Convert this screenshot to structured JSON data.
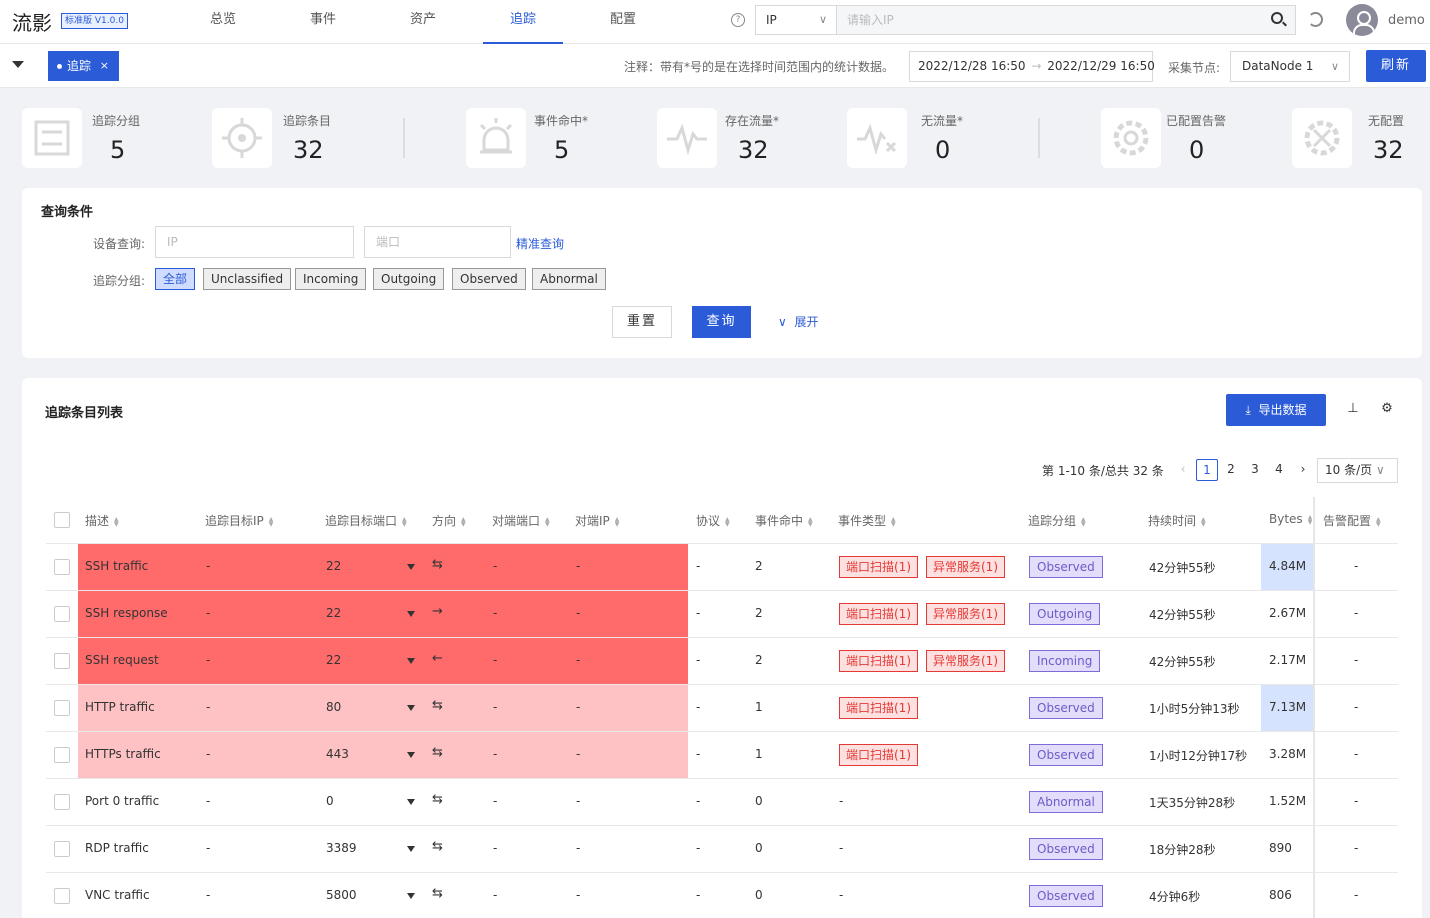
{
  "app": {
    "logo": "流影",
    "version": "标准版 V1.0.0"
  },
  "nav": [
    {
      "label": "总览"
    },
    {
      "label": "事件"
    },
    {
      "label": "资产"
    },
    {
      "label": "追踪"
    },
    {
      "label": "配置"
    }
  ],
  "search": {
    "type": "IP",
    "placeholder": "请输入IP"
  },
  "user": {
    "name": "demo"
  },
  "subbar": {
    "tab": "追踪",
    "tab_close": "×",
    "note": "注释：带有*号的是在选择时间范围内的统计数据。",
    "date_start": "2022/12/28 16:50",
    "date_arrow": "→",
    "date_end": "2022/12/29 16:50",
    "node_label": "采集节点:",
    "node_value": "DataNode 1",
    "refresh": "刷新"
  },
  "stats": [
    {
      "label": "追踪分组",
      "value": "5"
    },
    {
      "label": "追踪条目",
      "value": "32"
    },
    {
      "label": "事件命中*",
      "value": "5"
    },
    {
      "label": "存在流量*",
      "value": "32"
    },
    {
      "label": "无流量*",
      "value": "0"
    },
    {
      "label": "已配置告警",
      "value": "0"
    },
    {
      "label": "无配置",
      "value": "32"
    }
  ],
  "query": {
    "title": "查询条件",
    "device_label": "设备查询:",
    "ip_placeholder": "IP",
    "port_placeholder": "端口",
    "exact_link": "精准查询",
    "group_label": "追踪分组:",
    "groups": [
      "全部",
      "Unclassified",
      "Incoming",
      "Outgoing",
      "Observed",
      "Abnormal"
    ],
    "reset": "重置",
    "submit": "查询",
    "expand": "展开"
  },
  "list": {
    "title": "追踪条目列表",
    "export": "导出数据",
    "pager_info": "第 1-10 条/总共 32 条",
    "pages": [
      "1",
      "2",
      "3",
      "4"
    ],
    "prev": "‹",
    "next": "›",
    "page_size": "10 条/页",
    "columns": [
      "描述",
      "追踪目标IP",
      "追踪目标端口",
      "方向",
      "对端端口",
      "对端IP",
      "协议",
      "事件命中",
      "事件类型",
      "追踪分组",
      "持续时间",
      "Bytes",
      "告警配置"
    ],
    "rows": [
      {
        "desc": "SSH traffic",
        "ip": "-",
        "port": "22",
        "dir": "⇆",
        "peer_port": "-",
        "peer_ip": "-",
        "proto": "-",
        "hits": "2",
        "tags": [
          "端口扫描(1)",
          "异常服务(1)"
        ],
        "none": "",
        "group": "Observed",
        "duration": "42分钟55秒",
        "bytes": "4.84M",
        "alarm": "-"
      },
      {
        "desc": "SSH response",
        "ip": "-",
        "port": "22",
        "dir": "→",
        "peer_port": "-",
        "peer_ip": "-",
        "proto": "-",
        "hits": "2",
        "tags": [
          "端口扫描(1)",
          "异常服务(1)"
        ],
        "none": "",
        "group": "Outgoing",
        "duration": "42分钟55秒",
        "bytes": "2.67M",
        "alarm": "-"
      },
      {
        "desc": "SSH request",
        "ip": "-",
        "port": "22",
        "dir": "←",
        "peer_port": "-",
        "peer_ip": "-",
        "proto": "-",
        "hits": "2",
        "tags": [
          "端口扫描(1)",
          "异常服务(1)"
        ],
        "none": "",
        "group": "Incoming",
        "duration": "42分钟55秒",
        "bytes": "2.17M",
        "alarm": "-"
      },
      {
        "desc": "HTTP traffic",
        "ip": "-",
        "port": "80",
        "dir": "⇆",
        "peer_port": "-",
        "peer_ip": "-",
        "proto": "-",
        "hits": "1",
        "tags": [
          "端口扫描(1)"
        ],
        "none": "",
        "group": "Observed",
        "duration": "1小时5分钟13秒",
        "bytes": "7.13M",
        "alarm": "-"
      },
      {
        "desc": "HTTPs traffic",
        "ip": "-",
        "port": "443",
        "dir": "⇆",
        "peer_port": "-",
        "peer_ip": "-",
        "proto": "-",
        "hits": "1",
        "tags": [
          "端口扫描(1)"
        ],
        "none": "",
        "group": "Observed",
        "duration": "1小时12分钟17秒",
        "bytes": "3.28M",
        "alarm": "-"
      },
      {
        "desc": "Port 0 traffic",
        "ip": "-",
        "port": "0",
        "dir": "⇆",
        "peer_port": "-",
        "peer_ip": "-",
        "proto": "-",
        "hits": "0",
        "tags": [],
        "none": "-",
        "group": "Abnormal",
        "duration": "1天35分钟28秒",
        "bytes": "1.52M",
        "alarm": "-"
      },
      {
        "desc": "RDP traffic",
        "ip": "-",
        "port": "3389",
        "dir": "⇆",
        "peer_port": "-",
        "peer_ip": "-",
        "proto": "-",
        "hits": "0",
        "tags": [],
        "none": "-",
        "group": "Observed",
        "duration": "18分钟28秒",
        "bytes": "890",
        "alarm": "-"
      },
      {
        "desc": "VNC traffic",
        "ip": "-",
        "port": "5800",
        "dir": "⇆",
        "peer_port": "-",
        "peer_ip": "-",
        "proto": "-",
        "hits": "0",
        "tags": [],
        "none": "-",
        "group": "Observed",
        "duration": "4分钟6秒",
        "bytes": "806",
        "alarm": "-"
      }
    ]
  },
  "colors": {
    "accent": "#2b5bd7",
    "row_high": "#ff6b6b",
    "row_mid": "#ffc2c4",
    "tag_red": "#e53935",
    "tag_purple": "#7b6cd8",
    "bytes_highlight": "#d6e3ff"
  }
}
